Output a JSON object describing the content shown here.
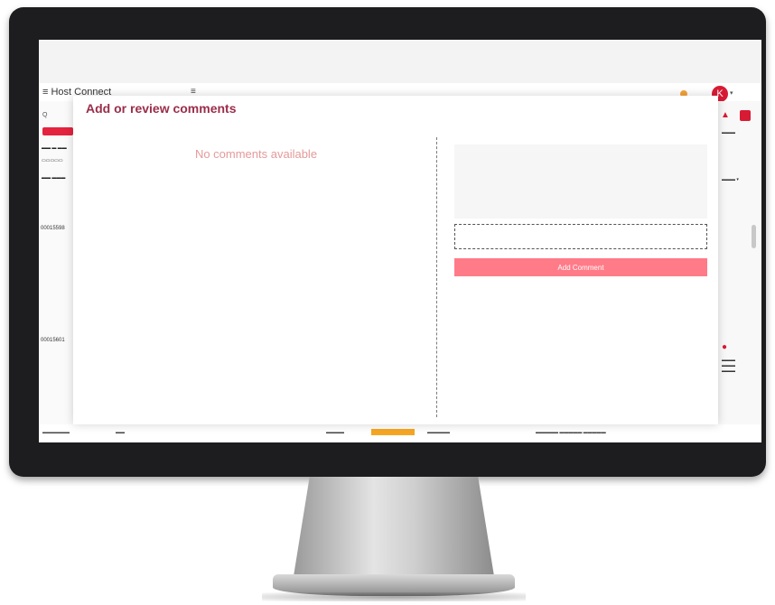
{
  "app": {
    "title": "≡ Host Connect",
    "user_initial": "K"
  },
  "left": {
    "search_label": "Q",
    "row_id_1": "00015598",
    "row_id_2": "00015601"
  },
  "modal": {
    "title": "Add or review comments",
    "empty_text": "No comments available",
    "comment_placeholder": "",
    "dropzone_text": "",
    "add_button": "Add Comment"
  },
  "colors": {
    "accent": "#e4233f",
    "button": "#ff7b88",
    "title": "#9b2d4a",
    "status": "#f5a623"
  },
  "icons": {
    "menu": "hamburger-icon",
    "alert": "warning-icon",
    "search": "search-icon"
  }
}
